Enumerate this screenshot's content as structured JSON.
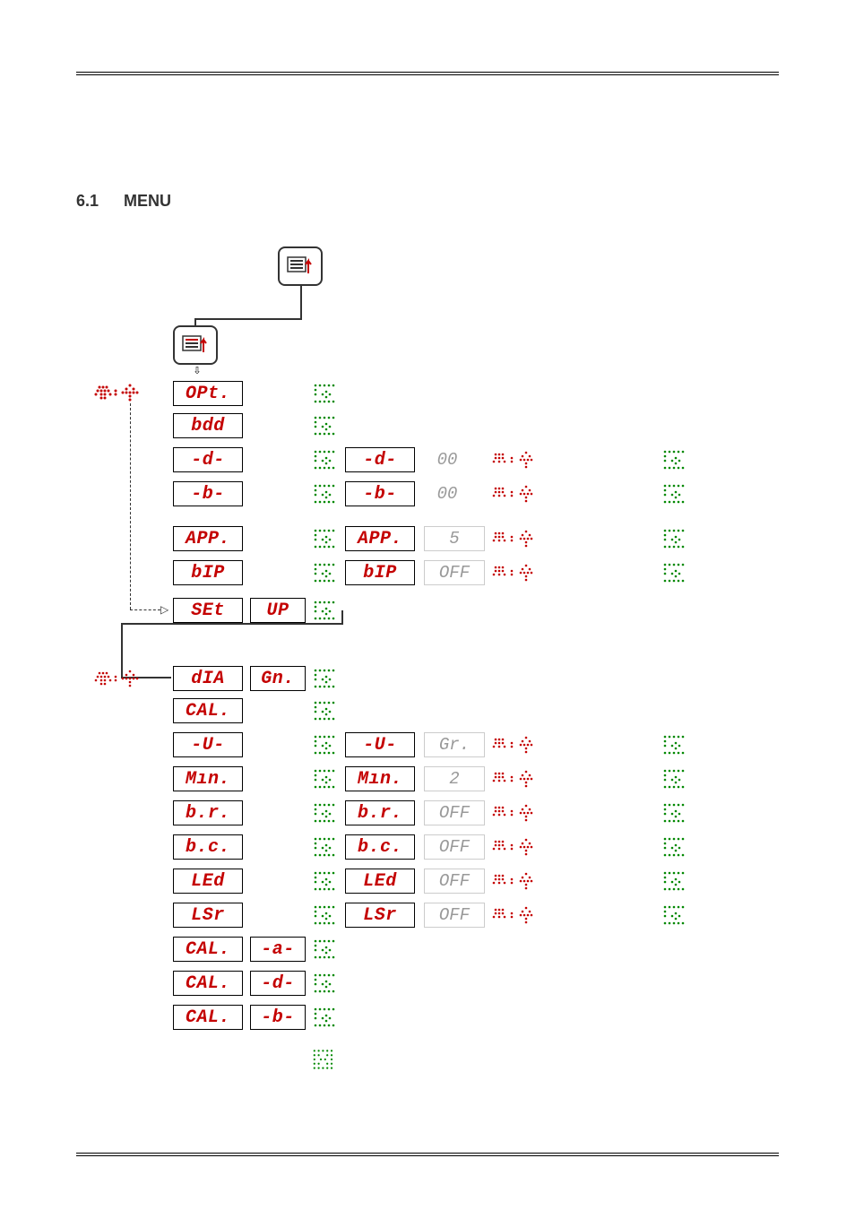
{
  "heading": {
    "num": "6.1",
    "title": "MENU"
  },
  "group1": {
    "items": [
      {
        "id": "opt",
        "label": "OPt."
      },
      {
        "id": "bdd",
        "label": "bdd"
      },
      {
        "id": "d",
        "label": "-d-",
        "sub_label": "-d-",
        "value": "00"
      },
      {
        "id": "b",
        "label": "-b-",
        "sub_label": "-b-",
        "value": "00"
      },
      {
        "id": "app",
        "label": "APP.",
        "sub_label": "APP.",
        "value": "5"
      },
      {
        "id": "bip",
        "label": "bIP",
        "sub_label": "bIP",
        "value": "OFF"
      },
      {
        "id": "set",
        "label": "SEt",
        "aux": "UP"
      }
    ]
  },
  "group2": {
    "items": [
      {
        "id": "dia",
        "label": "dIA",
        "aux": "Gn."
      },
      {
        "id": "cal",
        "label": "CAL."
      },
      {
        "id": "u",
        "label": "-U-",
        "sub_label": "-U-",
        "value": "Gr."
      },
      {
        "id": "min",
        "label": "Mın.",
        "sub_label": "Mın.",
        "value": "2"
      },
      {
        "id": "br",
        "label": "b.r.",
        "sub_label": "b.r.",
        "value": "OFF"
      },
      {
        "id": "bc",
        "label": "b.c.",
        "sub_label": "b.c.",
        "value": "OFF"
      },
      {
        "id": "led",
        "label": "LEd",
        "sub_label": "LEd",
        "value": "OFF"
      },
      {
        "id": "lsr",
        "label": "LSr",
        "sub_label": "LSr",
        "value": "OFF"
      },
      {
        "id": "cala",
        "label": "CAL.",
        "aux": "-a-"
      },
      {
        "id": "cald",
        "label": "CAL.",
        "aux": "-d-"
      },
      {
        "id": "calb",
        "label": "CAL.",
        "aux": "-b-"
      }
    ]
  }
}
